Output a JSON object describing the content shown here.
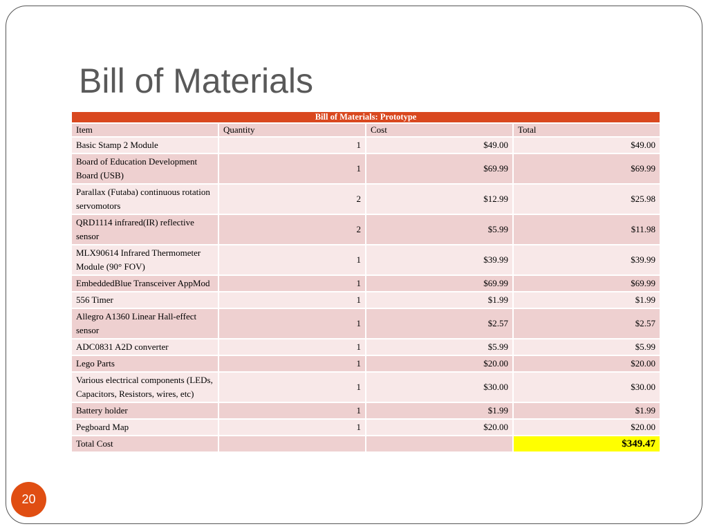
{
  "slide": {
    "title": "Bill of Materials",
    "page_number": "20"
  },
  "table": {
    "caption": "Bill of Materials: Prototype",
    "headers": [
      "Item",
      "Quantity",
      "Cost",
      "Total"
    ],
    "rows": [
      {
        "item": "Basic Stamp 2 Module",
        "qty": "1",
        "cost": "$49.00",
        "total": "$49.00"
      },
      {
        "item": "Board of Education Development Board (USB)",
        "qty": "1",
        "cost": "$69.99",
        "total": "$69.99"
      },
      {
        "item": "Parallax (Futaba) continuous rotation servomotors",
        "qty": "2",
        "cost": "$12.99",
        "total": "$25.98"
      },
      {
        "item": "QRD1114 infrared(IR) reflective sensor",
        "qty": "2",
        "cost": "$5.99",
        "total": "$11.98"
      },
      {
        "item": "MLX90614 Infrared Thermometer Module (90° FOV)",
        "qty": "1",
        "cost": "$39.99",
        "total": "$39.99"
      },
      {
        "item": " EmbeddedBlue Transceiver AppMod",
        "qty": "1",
        "cost": "$69.99",
        "total": "$69.99"
      },
      {
        "item": "556 Timer",
        "qty": "1",
        "cost": "$1.99",
        "total": "$1.99"
      },
      {
        "item": "Allegro A1360 Linear Hall-effect sensor",
        "qty": "1",
        "cost": "$2.57",
        "total": "$2.57"
      },
      {
        "item": "ADC0831 A2D converter",
        "qty": "1",
        "cost": "$5.99",
        "total": "$5.99"
      },
      {
        "item": "Lego Parts",
        "qty": "1",
        "cost": "$20.00",
        "total": "$20.00"
      },
      {
        "item": "Various electrical components (LEDs, Capacitors, Resistors, wires, etc)",
        "qty": "1",
        "cost": "$30.00",
        "total": "$30.00"
      },
      {
        "item": "Battery holder",
        "qty": "1",
        "cost": "$1.99",
        "total": "$1.99"
      },
      {
        "item": "Pegboard Map",
        "qty": "1",
        "cost": "$20.00",
        "total": "$20.00"
      }
    ],
    "total_label": "Total Cost",
    "total_value": "$349.47",
    "colors": {
      "caption_bg": "#d9481f",
      "row_dark": "#eed0d0",
      "row_light": "#f8e8e8",
      "total_highlight": "#ffff00",
      "page_badge": "#e04e12"
    }
  }
}
